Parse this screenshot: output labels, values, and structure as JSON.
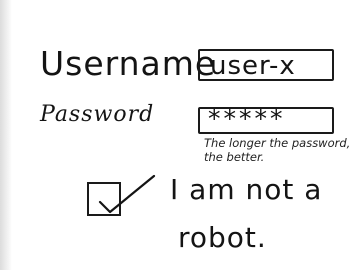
{
  "form": {
    "username": {
      "label": "Username",
      "value": "user-x"
    },
    "password": {
      "label": "Password",
      "value": "*****",
      "hint": "The longer the password, the better."
    },
    "captcha": {
      "checked": true,
      "label_line1": "I am not a",
      "label_line2": "robot."
    }
  },
  "icons": {
    "checkbox_mark": "check-icon"
  }
}
